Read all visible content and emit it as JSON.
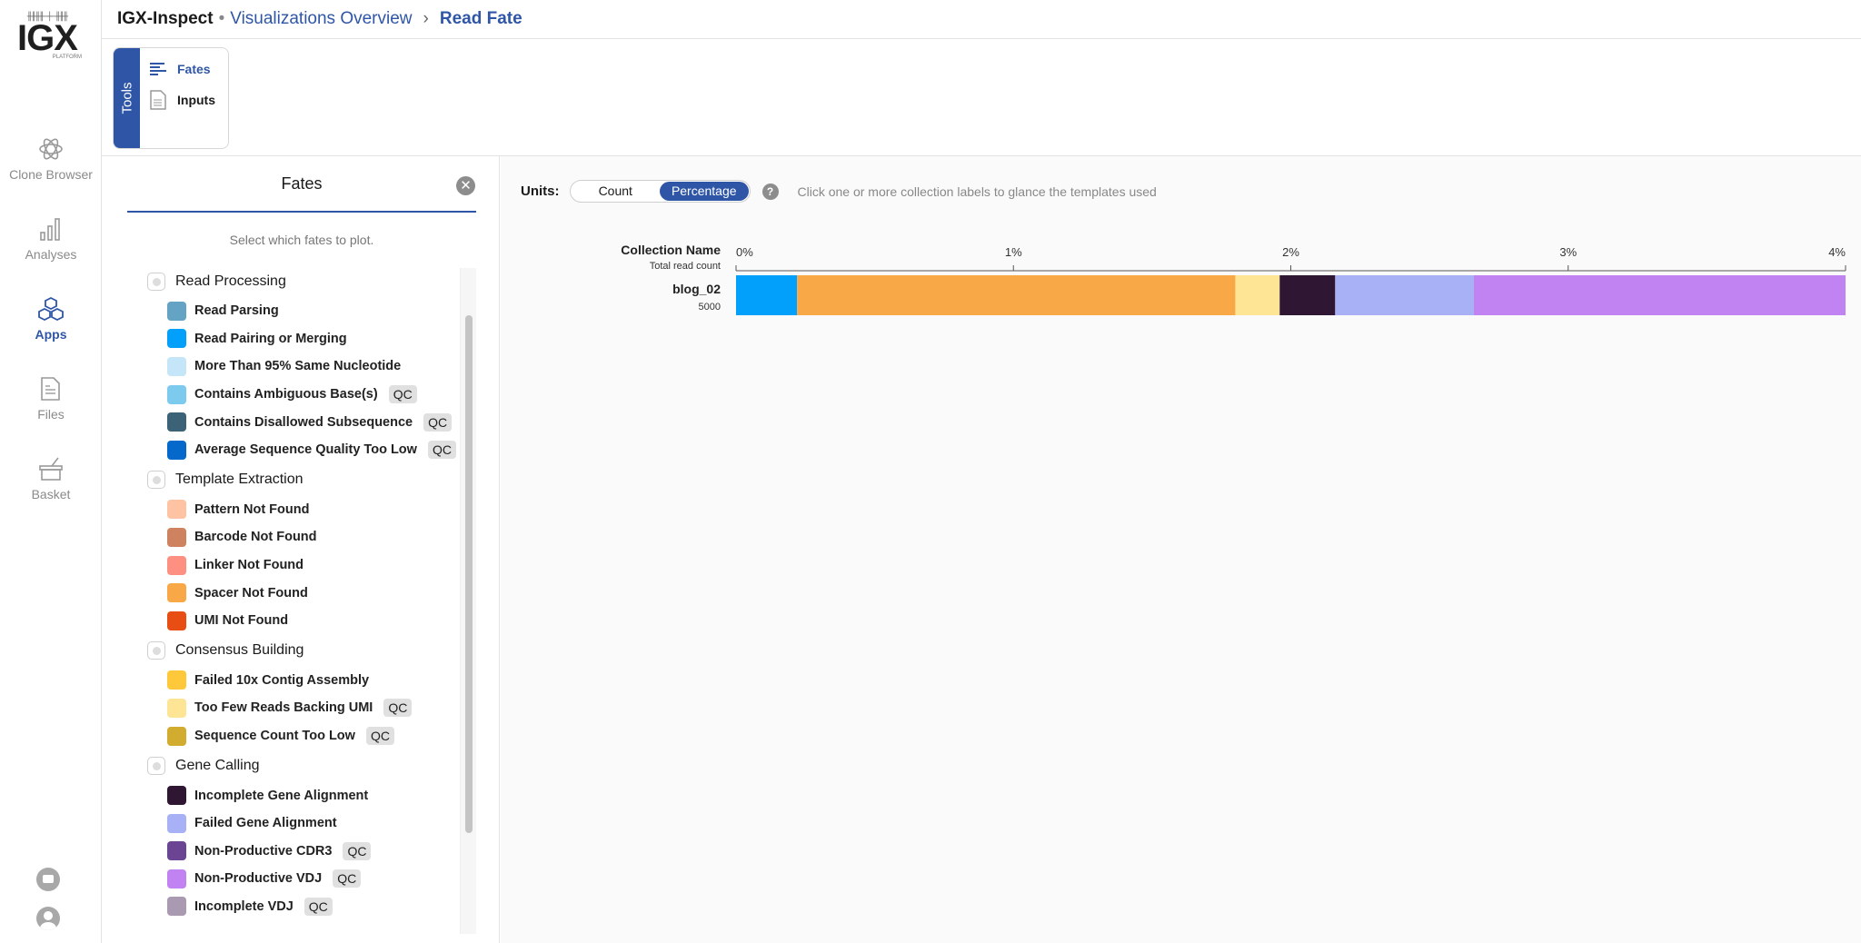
{
  "logo": {
    "text": "IGX",
    "sub": "PLATFORM"
  },
  "nav": [
    {
      "label": "Clone Browser",
      "icon": "atom-icon"
    },
    {
      "label": "Analyses",
      "icon": "bar-chart-icon"
    },
    {
      "label": "Apps",
      "icon": "cubes-icon",
      "active": true
    },
    {
      "label": "Files",
      "icon": "file-icon"
    },
    {
      "label": "Basket",
      "icon": "basket-icon"
    }
  ],
  "header": {
    "app": "IGX-Inspect",
    "sep": "•",
    "crumb": "Visualizations Overview",
    "arrow": "›",
    "current": "Read Fate"
  },
  "tools": {
    "tab": "Tools",
    "items": [
      {
        "label": "Fates",
        "icon": "lines-icon",
        "active": true
      },
      {
        "label": "Inputs",
        "icon": "document-icon"
      }
    ]
  },
  "panel": {
    "title": "Fates",
    "hint": "Select which fates to plot.",
    "qc": "QC",
    "groups": [
      {
        "label": "Read Processing",
        "items": [
          {
            "label": "Read Parsing",
            "color": "#64a3c3"
          },
          {
            "label": "Read Pairing or Merging",
            "color": "#03a0fb"
          },
          {
            "label": "More Than 95% Same Nucleotide",
            "color": "#c4e6f8"
          },
          {
            "label": "Contains Ambiguous Base(s)",
            "color": "#7dcaef",
            "qc": true
          },
          {
            "label": "Contains Disallowed Subsequence",
            "color": "#3c6277",
            "qc": true
          },
          {
            "label": "Average Sequence Quality Too Low",
            "color": "#0469cb",
            "qc": true
          }
        ]
      },
      {
        "label": "Template Extraction",
        "items": [
          {
            "label": "Pattern Not Found",
            "color": "#fdc3a3"
          },
          {
            "label": "Barcode Not Found",
            "color": "#cf8260"
          },
          {
            "label": "Linker Not Found",
            "color": "#fd9080"
          },
          {
            "label": "Spacer Not Found",
            "color": "#f9a848"
          },
          {
            "label": "UMI Not Found",
            "color": "#e84e14"
          }
        ]
      },
      {
        "label": "Consensus Building",
        "items": [
          {
            "label": "Failed 10x Contig Assembly",
            "color": "#fec83a"
          },
          {
            "label": "Too Few Reads Backing UMI",
            "color": "#fde595",
            "qc": true
          },
          {
            "label": "Sequence Count Too Low",
            "color": "#d2ac2f",
            "qc": true
          }
        ]
      },
      {
        "label": "Gene Calling",
        "items": [
          {
            "label": "Incomplete Gene Alignment",
            "color": "#2f1734"
          },
          {
            "label": "Failed Gene Alignment",
            "color": "#a8b1f5"
          },
          {
            "label": "Non-Productive CDR3",
            "color": "#6b4593",
            "qc": true
          },
          {
            "label": "Non-Productive VDJ",
            "color": "#c083f1",
            "qc": true
          },
          {
            "label": "Incomplete VDJ",
            "color": "#a99ab2",
            "qc": true
          }
        ]
      }
    ]
  },
  "units": {
    "label": "Units:",
    "options": [
      "Count",
      "Percentage"
    ],
    "selected": "Percentage",
    "help": "?",
    "message": "Click one or more collection labels to glance the templates used"
  },
  "chart_data": {
    "type": "bar",
    "orientation": "horizontal",
    "stacked": true,
    "header": "Collection Name",
    "subheader": "Total read count",
    "xlim": [
      0,
      4
    ],
    "ticks": [
      "0%",
      "1%",
      "2%",
      "3%",
      "4%"
    ],
    "tick_values": [
      0,
      1,
      2,
      3,
      4
    ],
    "axis_position": "top",
    "categories": [
      {
        "name": "blog_02",
        "total": "5000"
      }
    ],
    "series": [
      {
        "name": "Read Pairing or Merging",
        "color": "#03a0fb",
        "values": [
          0.22
        ]
      },
      {
        "name": "Spacer Not Found",
        "color": "#f9a848",
        "values": [
          1.58
        ]
      },
      {
        "name": "Too Few Reads Backing UMI",
        "color": "#fde595",
        "values": [
          0.16
        ]
      },
      {
        "name": "Incomplete Gene Alignment",
        "color": "#2f1734",
        "values": [
          0.2
        ]
      },
      {
        "name": "Failed Gene Alignment",
        "color": "#a8b1f5",
        "values": [
          0.5
        ]
      },
      {
        "name": "Non-Productive VDJ",
        "color": "#c083f1",
        "values": [
          1.34
        ]
      }
    ]
  }
}
